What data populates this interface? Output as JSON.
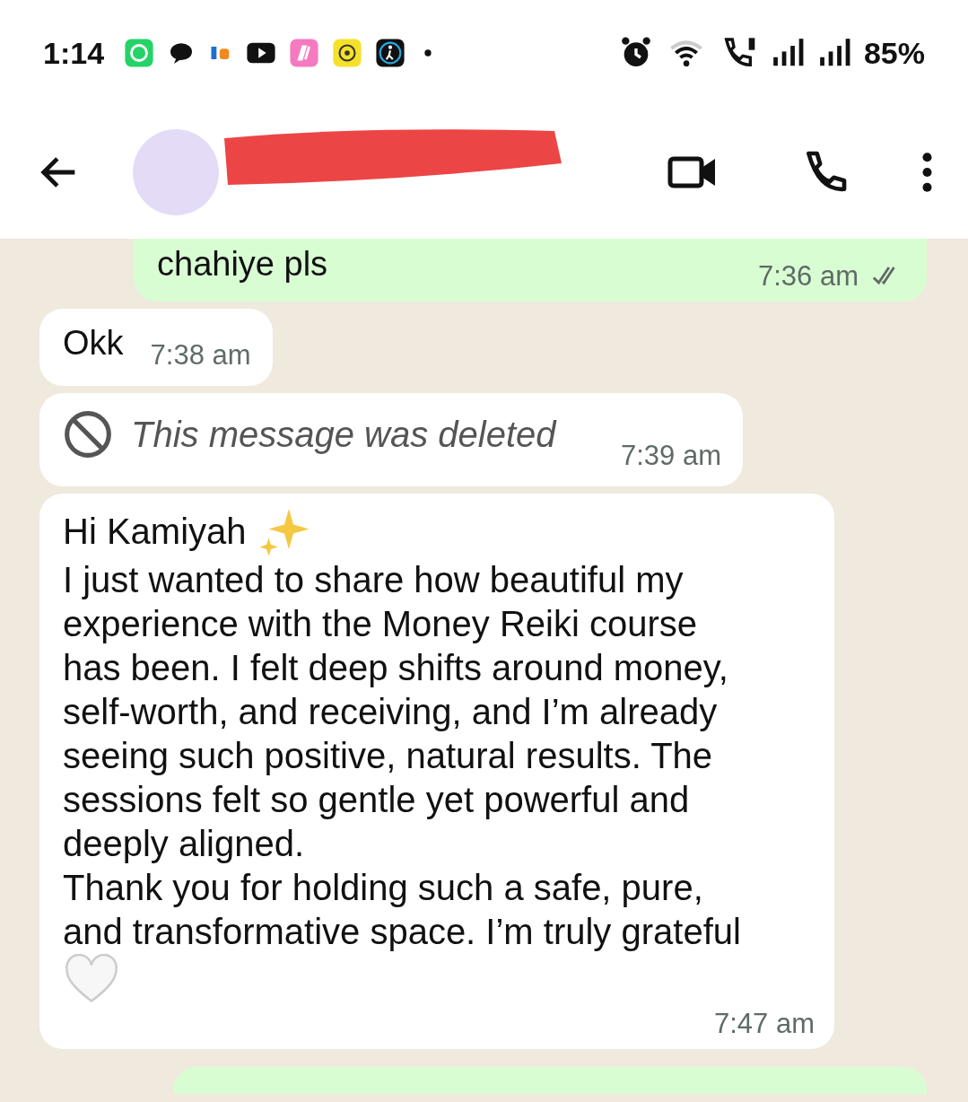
{
  "status_bar": {
    "time": "1:14",
    "battery": "85%"
  },
  "header": {
    "redacted_name": true
  },
  "messages": [
    {
      "kind": "text",
      "outgoing": true,
      "paragraphs": [
        "chahiye pls"
      ],
      "time": "7:36 am"
    },
    {
      "kind": "text",
      "outgoing": false,
      "paragraphs": [
        "Okk"
      ],
      "time": "7:38 am"
    },
    {
      "kind": "deleted",
      "outgoing": false,
      "paragraphs": [
        "This message was deleted"
      ],
      "time": "7:39 am"
    },
    {
      "kind": "long",
      "outgoing": false,
      "paragraphs": [
        "Hi Kamiyah",
        "I just wanted to share how beautiful my experience with the Money Reiki course has been. I felt deep shifts around money, self-worth, and receiving, and I’m already seeing such positive, natural results. The sessions felt so gentle yet powerful and deeply aligned.",
        "Thank you for holding such a safe, pure, and transformative space. I’m truly grateful"
      ],
      "time": "7:47 am"
    },
    {
      "kind": "partial",
      "outgoing": true
    }
  ]
}
